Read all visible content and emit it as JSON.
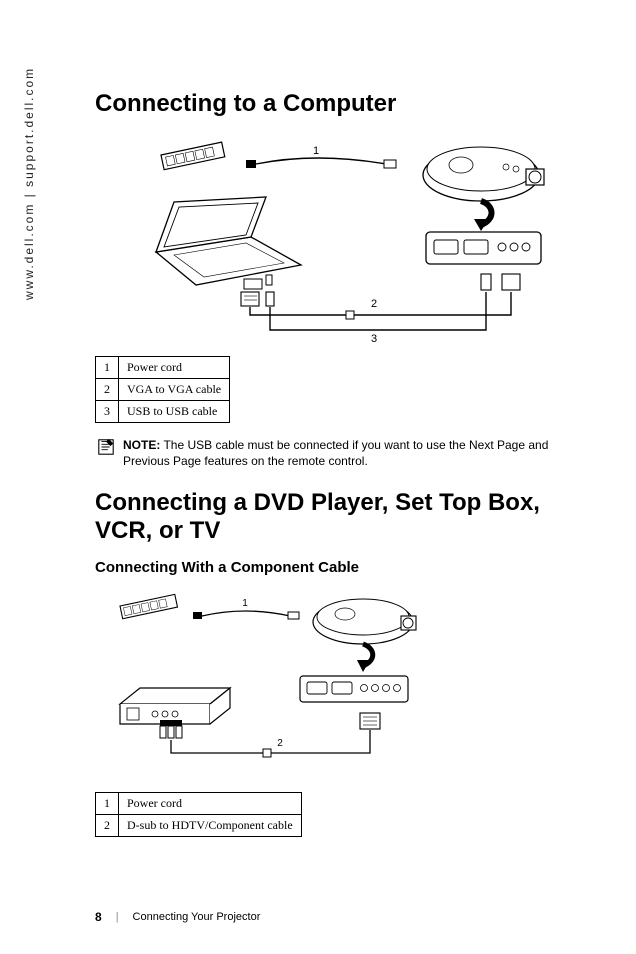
{
  "side_text": "www.dell.com | support.dell.com",
  "heading1": "Connecting to a Computer",
  "diagram1": {
    "labels": {
      "cable1": "1",
      "cable2": "2",
      "cable3": "3"
    }
  },
  "table1": {
    "rows": [
      {
        "num": "1",
        "desc": "Power cord"
      },
      {
        "num": "2",
        "desc": "VGA to VGA cable"
      },
      {
        "num": "3",
        "desc": "USB to USB cable"
      }
    ]
  },
  "note": {
    "label": "NOTE:",
    "text": "The USB cable must be connected if you want to use the Next Page and Previous Page features on the remote control."
  },
  "heading2": "Connecting a DVD Player, Set Top Box, VCR, or TV",
  "subheading2": "Connecting With a Component Cable",
  "diagram2": {
    "labels": {
      "cable1": "1",
      "cable2": "2"
    }
  },
  "table2": {
    "rows": [
      {
        "num": "1",
        "desc": "Power cord"
      },
      {
        "num": "2",
        "desc": "D-sub to HDTV/Component cable"
      }
    ]
  },
  "footer": {
    "page": "8",
    "section": "Connecting Your Projector"
  }
}
